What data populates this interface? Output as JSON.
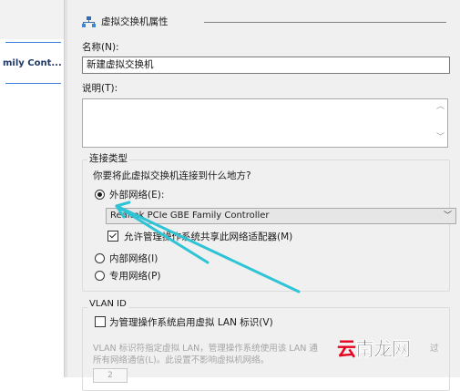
{
  "left_pane": {
    "item_label": "mily Cont..."
  },
  "header": {
    "title": "虚拟交换机属性"
  },
  "name_field": {
    "label": "名称(N):",
    "value": "新建虚拟交换机"
  },
  "notes": {
    "label": "说明(T):",
    "value": ""
  },
  "connection": {
    "group_title": "连接类型",
    "question": "你要将此虚拟交换机连接到什么地方?",
    "external": {
      "label": "外部网络(E):",
      "checked": true
    },
    "adapter": {
      "selected": "Realtek PCIe GBE Family Controller"
    },
    "allow_share": {
      "label": "允许管理操作系统共享此网络适配器(M)",
      "checked": true
    },
    "internal": {
      "label": "内部网络(I)",
      "checked": false
    },
    "private": {
      "label": "专用网络(P)",
      "checked": false
    }
  },
  "vlan": {
    "group_title": "VLAN ID",
    "enable": {
      "label": "为管理操作系统启用虚拟 LAN 标识(V)",
      "checked": false
    },
    "desc_line1": "VLAN 标识符指定虚拟 LAN，管理操作系统使用该 LAN 通",
    "desc_line1_tail": "过",
    "desc_line2": "所有网络通信(L)。此设置不影响虚拟机网络。",
    "id_value": "2"
  },
  "watermark": {
    "first": "云",
    "rest": "南龙网"
  },
  "colors": {
    "arrow": "#2ec4d6",
    "accent": "#3c7fd6"
  }
}
